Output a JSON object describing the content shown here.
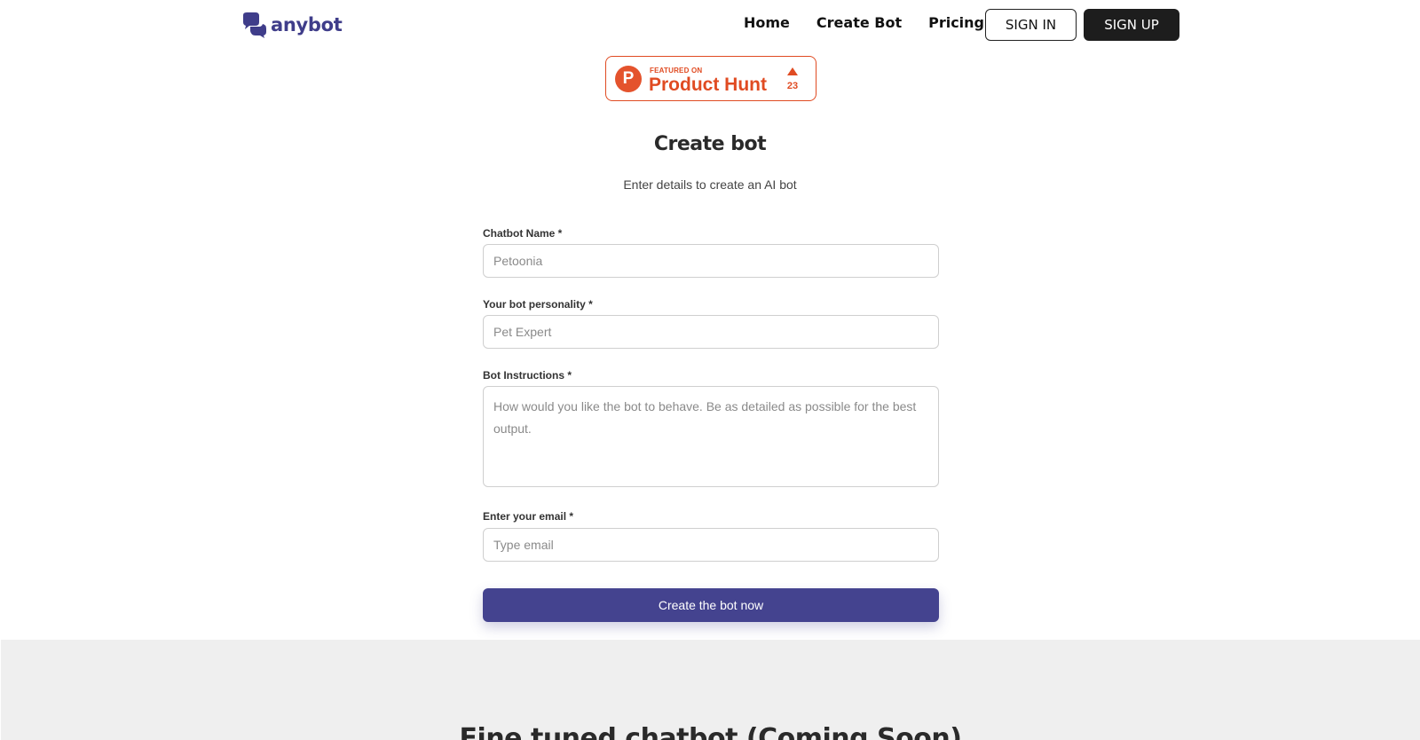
{
  "brand": {
    "name": "anybot",
    "color": "#3f3d8a"
  },
  "nav": {
    "items": [
      {
        "label": "Home"
      },
      {
        "label": "Create Bot"
      },
      {
        "label": "Pricing"
      }
    ],
    "sign_in": "SIGN IN",
    "sign_up": "SIGN UP"
  },
  "product_hunt": {
    "featured": "FEATURED ON",
    "name": "Product Hunt",
    "logo_letter": "P",
    "votes": "23",
    "color": "#e04b22"
  },
  "main": {
    "title": "Create bot",
    "subtitle": "Enter details to create an AI bot"
  },
  "form": {
    "name_label": "Chatbot Name *",
    "name_placeholder": "Petoonia",
    "personality_label": "Your bot personality *",
    "personality_placeholder": "Pet Expert",
    "instructions_label": "Bot Instructions *",
    "instructions_placeholder": "How would you like the bot to behave. Be as detailed as possible for the best output.",
    "email_label": "Enter your email *",
    "email_placeholder": "Type email",
    "submit_label": "Create the bot now",
    "submit_color": "#44438f"
  },
  "section2": {
    "title": "Fine tuned chatbot (Coming Soon)"
  }
}
